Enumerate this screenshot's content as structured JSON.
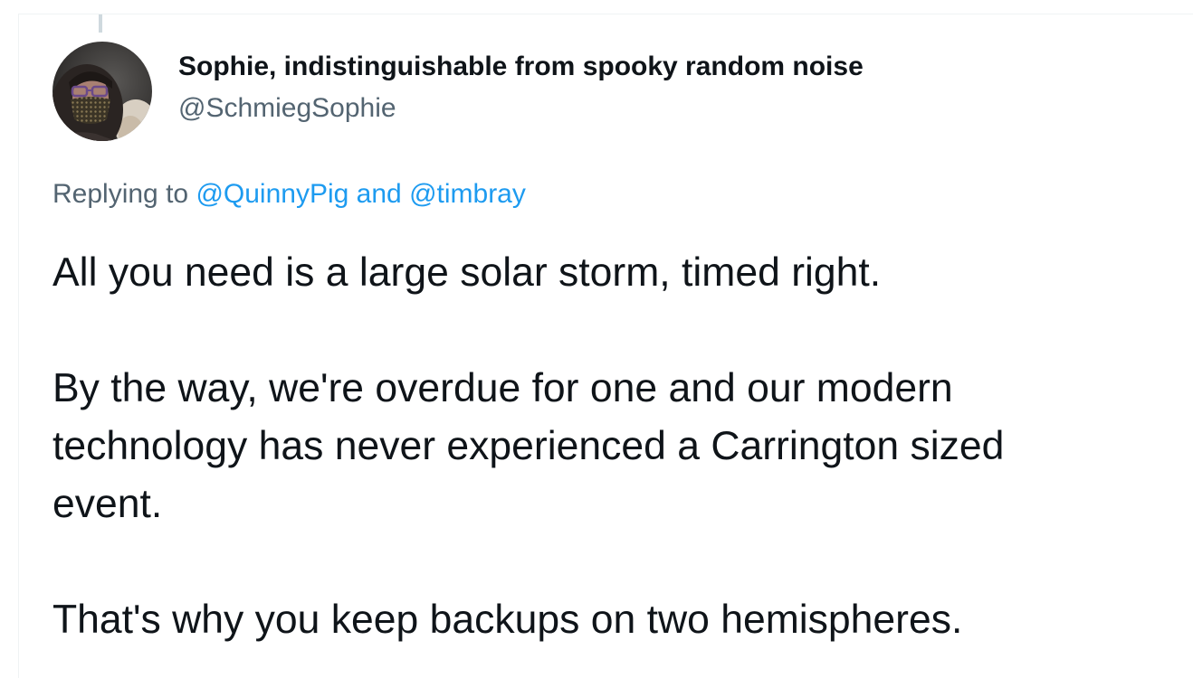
{
  "author": {
    "display_name": "Sophie, indistinguishable from spooky random noise",
    "handle": "@SchmiegSophie"
  },
  "reply": {
    "prefix": "Replying to",
    "mentions": [
      "@QuinnyPig",
      "@timbray"
    ],
    "joiner": "and"
  },
  "tweet": {
    "paragraphs": [
      [
        "All you need is a large solar storm, timed right."
      ],
      [
        "By the way, we're overdue for one and our modern",
        "technology has never experienced a Carrington sized",
        "event."
      ],
      [
        "That's why you keep backups on two hemispheres."
      ]
    ]
  },
  "colors": {
    "text": "#0f1419",
    "secondary": "#536471",
    "link": "#1d9bf0",
    "border": "#eff3f4"
  }
}
